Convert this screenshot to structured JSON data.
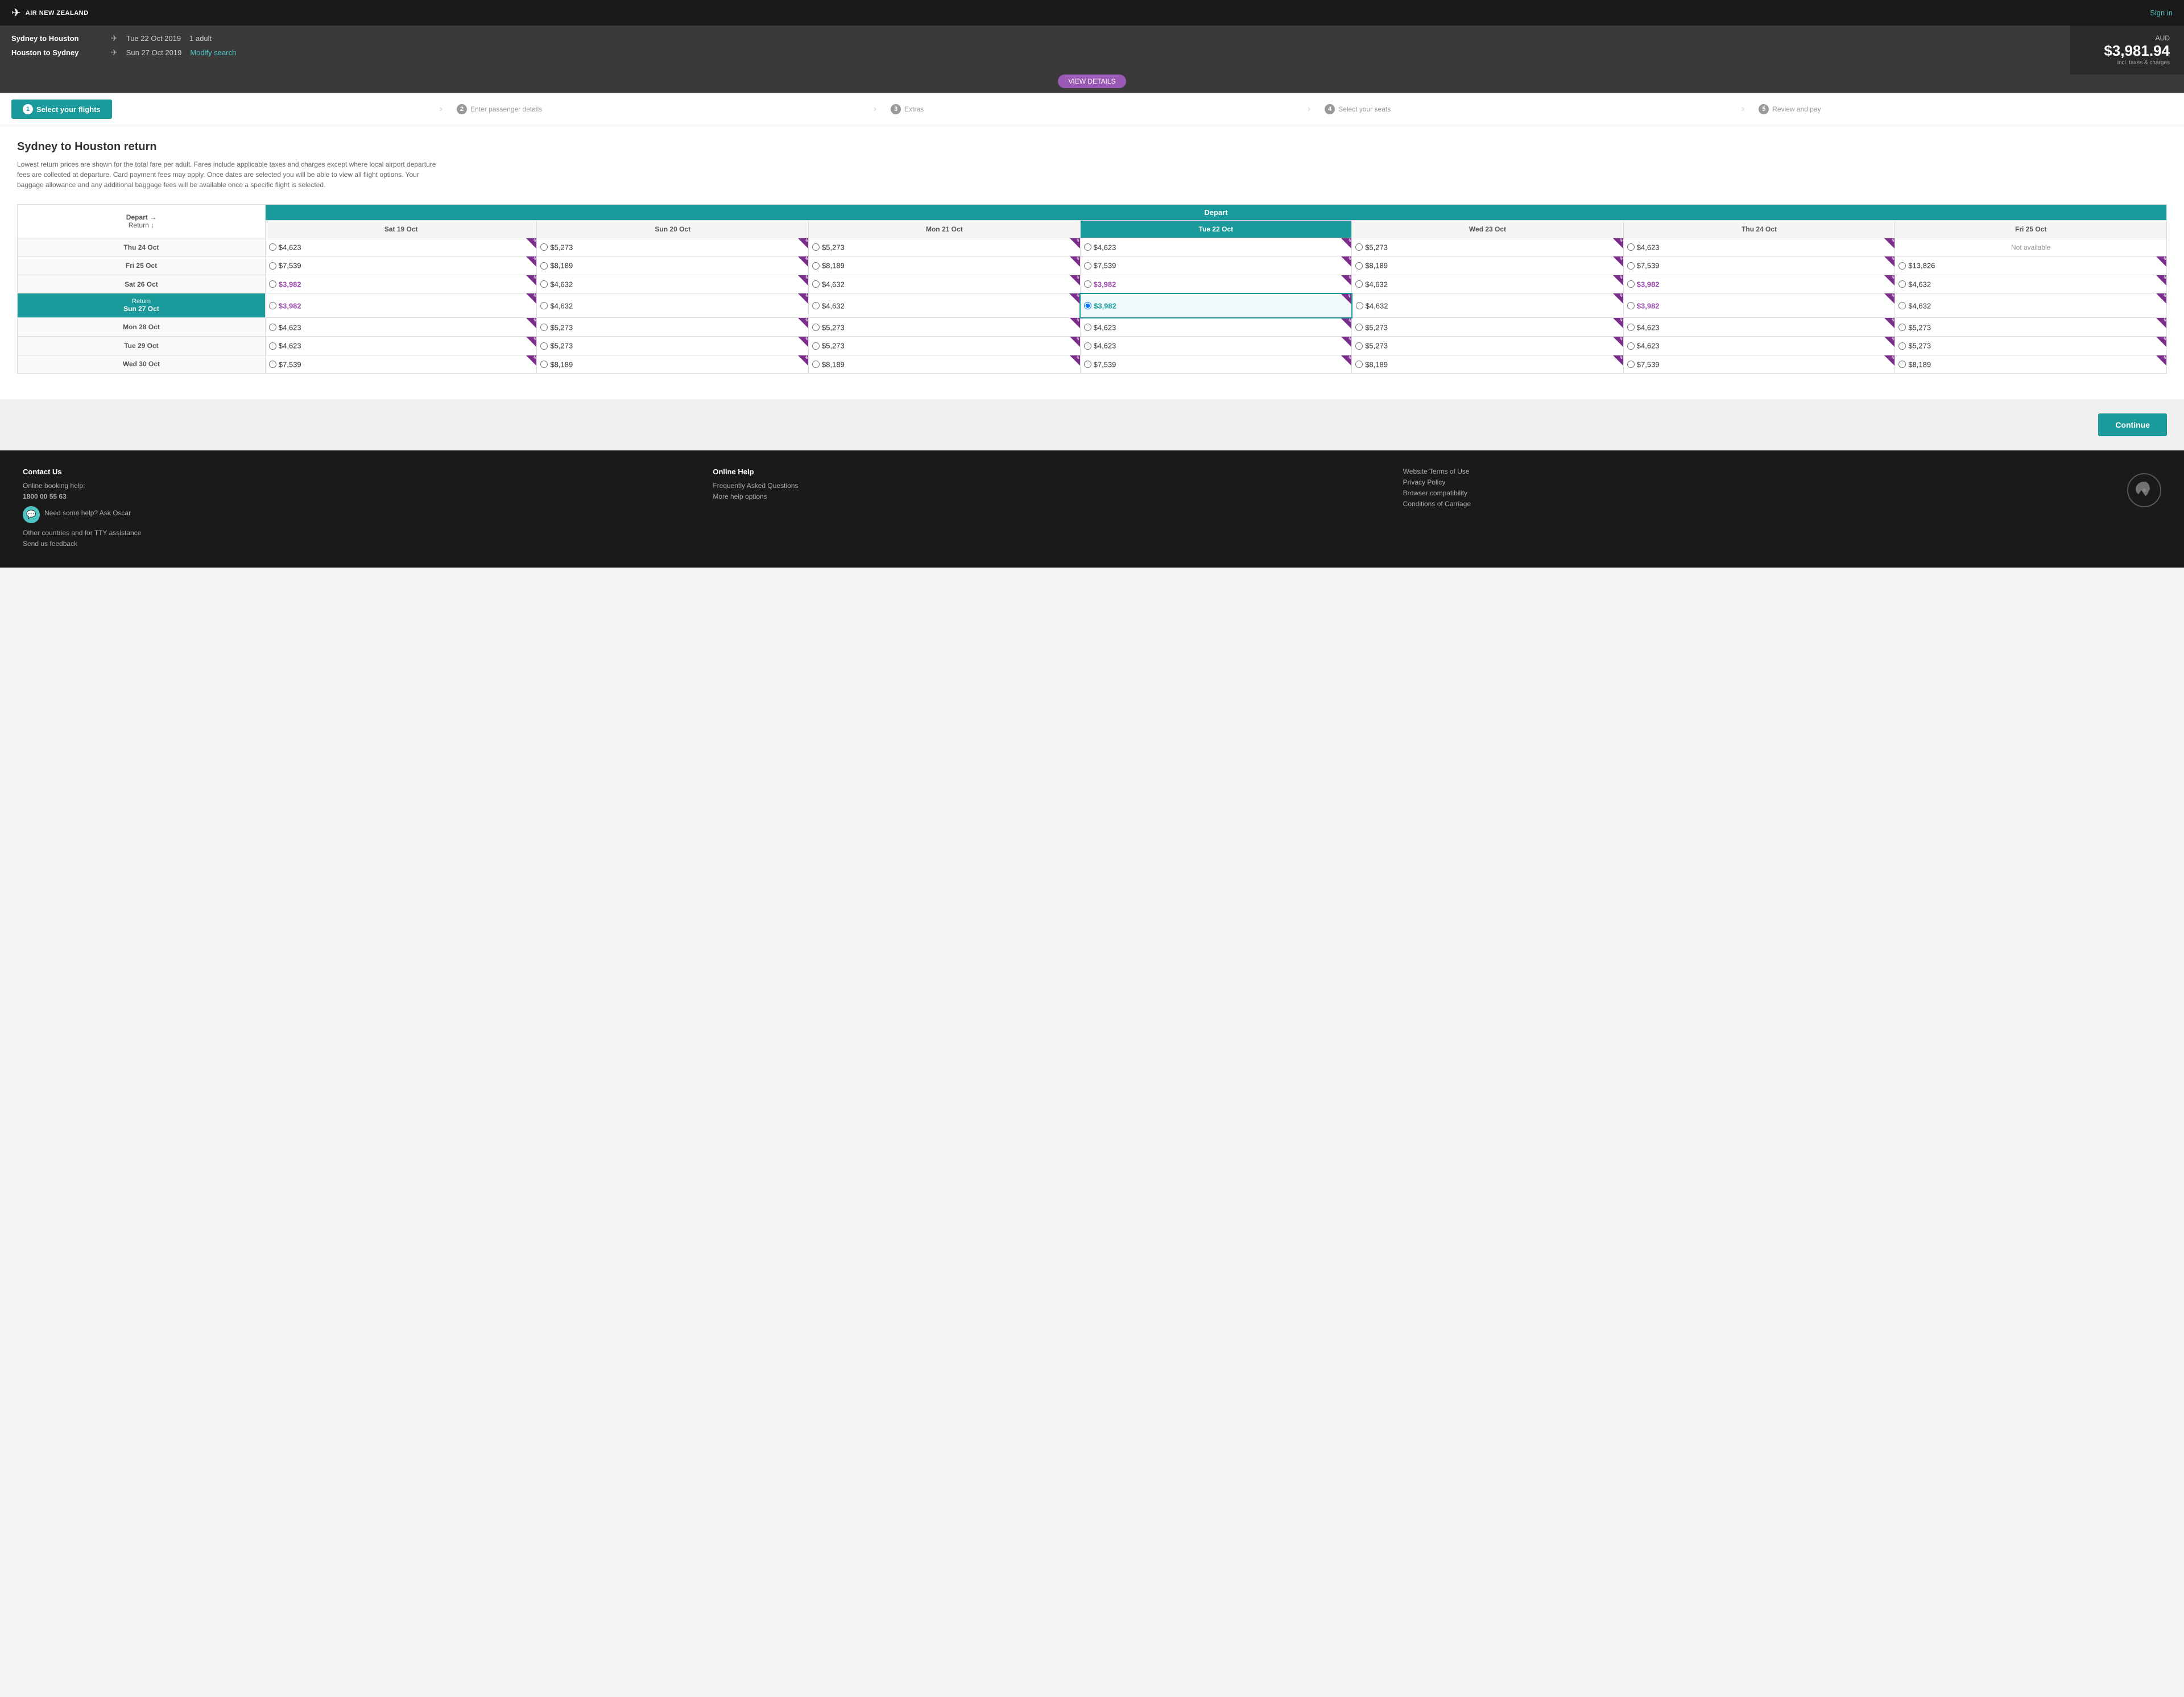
{
  "header": {
    "logo_text": "AIR NEW ZEALAND",
    "sign_in_label": "Sign in"
  },
  "booking_bar": {
    "route1": "Sydney to Houston",
    "date1": "Tue 22 Oct 2019",
    "pax": "1 adult",
    "route2": "Houston to Sydney",
    "date2": "Sun 27 Oct 2019",
    "modify_label": "Modify search",
    "price_currency": "AUD",
    "price_amount": "$3,981.94",
    "price_incl": "incl. taxes & charges",
    "view_details_label": "VIEW DETAILS"
  },
  "progress": {
    "steps": [
      {
        "num": "1",
        "label": "Select your flights",
        "active": true
      },
      {
        "num": "2",
        "label": "Enter passenger details",
        "active": false
      },
      {
        "num": "3",
        "label": "Extras",
        "active": false
      },
      {
        "num": "4",
        "label": "Select your seats",
        "active": false
      },
      {
        "num": "5",
        "label": "Review and pay",
        "active": false
      }
    ]
  },
  "main": {
    "title": "Sydney to Houston return",
    "description": "Lowest return prices are shown for the total fare per adult. Fares include applicable taxes and charges except where local airport departure fees are collected at departure. Card payment fees may apply. Once dates are selected you will be able to view all flight options. Your baggage allowance and any additional baggage fees will be available once a specific flight is selected.",
    "depart_header": "Depart",
    "corner_depart": "Depart →",
    "corner_return": "Return ↓",
    "col_headers": [
      "Sat 19 Oct",
      "Sun 20 Oct",
      "Mon 21 Oct",
      "Tue 22 Oct",
      "Wed 23 Oct",
      "Thu 24 Oct",
      "Fri 25 Oct"
    ],
    "selected_col": 3,
    "rows": [
      {
        "label": "Thu 24 Oct",
        "selected": false,
        "cells": [
          {
            "price": "$4,623",
            "discounted": false,
            "available": true
          },
          {
            "price": "$5,273",
            "discounted": false,
            "available": true
          },
          {
            "price": "$5,273",
            "discounted": false,
            "available": true
          },
          {
            "price": "$4,623",
            "discounted": false,
            "available": true
          },
          {
            "price": "$5,273",
            "discounted": false,
            "available": true
          },
          {
            "price": "$4,623",
            "discounted": false,
            "available": true
          },
          {
            "price": "Not available",
            "discounted": false,
            "available": false
          }
        ]
      },
      {
        "label": "Fri 25 Oct",
        "selected": false,
        "cells": [
          {
            "price": "$7,539",
            "discounted": false,
            "available": true
          },
          {
            "price": "$8,189",
            "discounted": false,
            "available": true
          },
          {
            "price": "$8,189",
            "discounted": false,
            "available": true
          },
          {
            "price": "$7,539",
            "discounted": false,
            "available": true
          },
          {
            "price": "$8,189",
            "discounted": false,
            "available": true
          },
          {
            "price": "$7,539",
            "discounted": false,
            "available": true
          },
          {
            "price": "$13,826",
            "discounted": false,
            "available": true
          }
        ]
      },
      {
        "label": "Sat 26 Oct",
        "selected": false,
        "cells": [
          {
            "price": "$3,982",
            "discounted": true,
            "available": true
          },
          {
            "price": "$4,632",
            "discounted": false,
            "available": true
          },
          {
            "price": "$4,632",
            "discounted": false,
            "available": true
          },
          {
            "price": "$3,982",
            "discounted": true,
            "available": true
          },
          {
            "price": "$4,632",
            "discounted": false,
            "available": true
          },
          {
            "price": "$3,982",
            "discounted": true,
            "available": true
          },
          {
            "price": "$4,632",
            "discounted": false,
            "available": true
          }
        ]
      },
      {
        "label": "Sun 27 Oct",
        "selected": true,
        "cells": [
          {
            "price": "$3,982",
            "discounted": true,
            "available": true
          },
          {
            "price": "$4,632",
            "discounted": false,
            "available": true
          },
          {
            "price": "$4,632",
            "discounted": false,
            "available": true
          },
          {
            "price": "$3,982",
            "discounted": true,
            "available": true,
            "selected": true
          },
          {
            "price": "$4,632",
            "discounted": false,
            "available": true
          },
          {
            "price": "$3,982",
            "discounted": true,
            "available": true
          },
          {
            "price": "$4,632",
            "discounted": false,
            "available": true
          }
        ]
      },
      {
        "label": "Mon 28 Oct",
        "selected": false,
        "cells": [
          {
            "price": "$4,623",
            "discounted": false,
            "available": true
          },
          {
            "price": "$5,273",
            "discounted": false,
            "available": true
          },
          {
            "price": "$5,273",
            "discounted": false,
            "available": true
          },
          {
            "price": "$4,623",
            "discounted": false,
            "available": true
          },
          {
            "price": "$5,273",
            "discounted": false,
            "available": true
          },
          {
            "price": "$4,623",
            "discounted": false,
            "available": true
          },
          {
            "price": "$5,273",
            "discounted": false,
            "available": true
          }
        ]
      },
      {
        "label": "Tue 29 Oct",
        "selected": false,
        "cells": [
          {
            "price": "$4,623",
            "discounted": false,
            "available": true
          },
          {
            "price": "$5,273",
            "discounted": false,
            "available": true
          },
          {
            "price": "$5,273",
            "discounted": false,
            "available": true
          },
          {
            "price": "$4,623",
            "discounted": false,
            "available": true
          },
          {
            "price": "$5,273",
            "discounted": false,
            "available": true
          },
          {
            "price": "$4,623",
            "discounted": false,
            "available": true
          },
          {
            "price": "$5,273",
            "discounted": false,
            "available": true
          }
        ]
      },
      {
        "label": "Wed 30 Oct",
        "selected": false,
        "cells": [
          {
            "price": "$7,539",
            "discounted": false,
            "available": true
          },
          {
            "price": "$8,189",
            "discounted": false,
            "available": true
          },
          {
            "price": "$8,189",
            "discounted": false,
            "available": true
          },
          {
            "price": "$7,539",
            "discounted": false,
            "available": true
          },
          {
            "price": "$8,189",
            "discounted": false,
            "available": true
          },
          {
            "price": "$7,539",
            "discounted": false,
            "available": true
          },
          {
            "price": "$8,189",
            "discounted": false,
            "available": true
          }
        ]
      }
    ]
  },
  "continue": {
    "label": "Continue"
  },
  "footer": {
    "contact_title": "Contact Us",
    "contact_booking": "Online booking help:",
    "contact_phone": "1800 00 55 63",
    "contact_other": "Other countries and for TTY assistance",
    "contact_feedback": "Send us feedback",
    "oscar_label": "Need some help? Ask Oscar",
    "online_title": "Online Help",
    "online_faq": "Frequently Asked Questions",
    "online_more": "More help options",
    "legal_title": "Website Terms of Use",
    "legal_privacy": "Privacy Policy",
    "legal_browser": "Browser compatibility",
    "legal_carriage": "Conditions of Carriage"
  }
}
